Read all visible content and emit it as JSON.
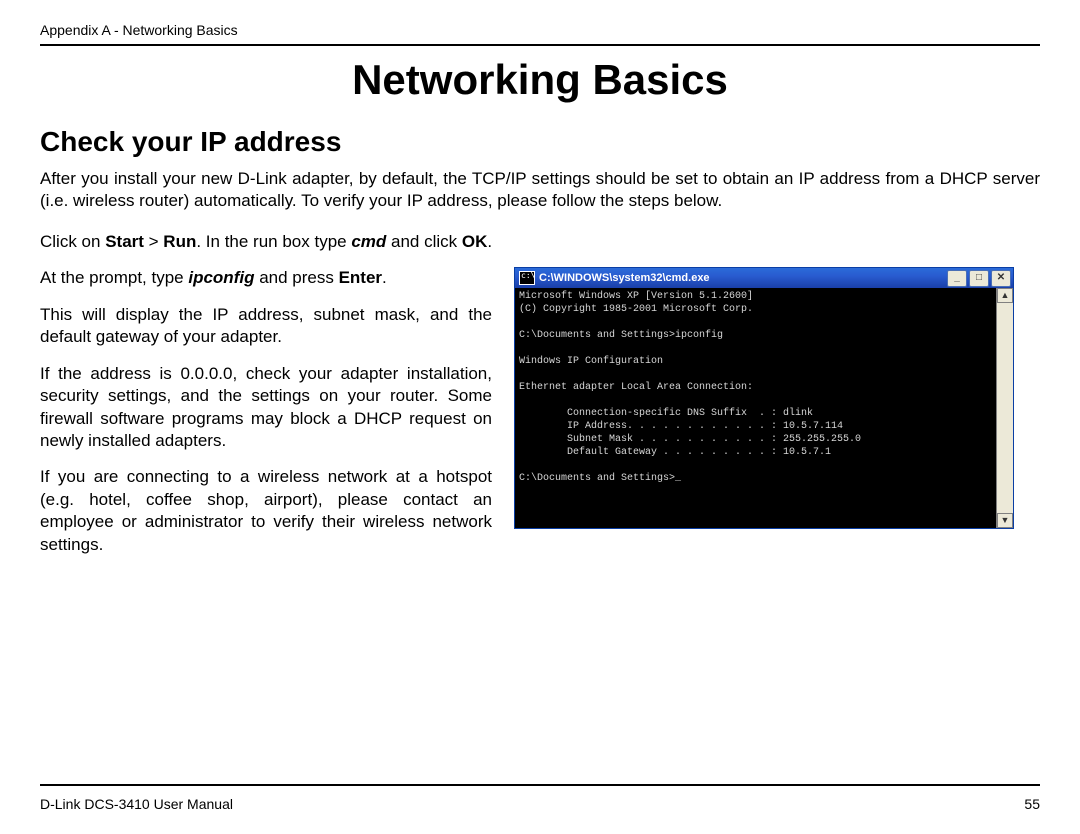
{
  "running_head": "Appendix A - Networking Basics",
  "title": "Networking Basics",
  "section": "Check your IP address",
  "intro": "After you install your new D-Link adapter, by default, the TCP/IP settings should be set to obtain an IP address from a DHCP server (i.e. wireless router) automatically. To verify your IP address, please follow the steps below.",
  "step1_pre": "Click on ",
  "bold_start": "Start",
  "gt": " > ",
  "bold_run": "Run",
  "step1_mid": ". In the run box type ",
  "bi_cmd": "cmd",
  "step1_post": " and click ",
  "bold_ok": "OK",
  "period": ".",
  "step2_pre": "At the prompt, type ",
  "bi_ipconfig": "ipconfig",
  "step2_mid": " and press ",
  "bold_enter": "Enter",
  "para3": "This will display the IP address, subnet mask, and the default gateway of your adapter.",
  "para4": "If the address is 0.0.0.0, check your adapter installation, security settings, and the settings on your router. Some firewall software programs may block a DHCP request on newly installed adapters.",
  "para5": "If you are connecting to a wireless network at a hotspot (e.g. hotel, coffee shop, airport), please contact an employee or administrator to verify their wireless network settings.",
  "cmd": {
    "title": "C:\\WINDOWS\\system32\\cmd.exe",
    "lines": "Microsoft Windows XP [Version 5.1.2600]\n(C) Copyright 1985-2001 Microsoft Corp.\n\nC:\\Documents and Settings>ipconfig\n\nWindows IP Configuration\n\nEthernet adapter Local Area Connection:\n\n        Connection-specific DNS Suffix  . : dlink\n        IP Address. . . . . . . . . . . . : 10.5.7.114\n        Subnet Mask . . . . . . . . . . . : 255.255.255.0\n        Default Gateway . . . . . . . . . : 10.5.7.1\n\nC:\\Documents and Settings>_"
  },
  "footer_left": "D-Link DCS-3410 User Manual",
  "footer_right": "55"
}
